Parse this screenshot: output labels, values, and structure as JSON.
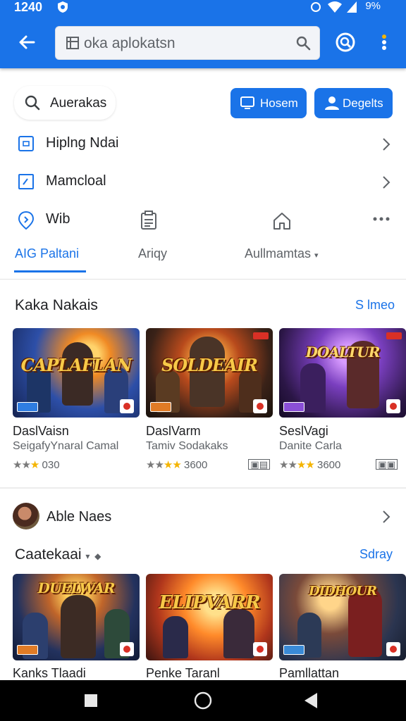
{
  "status": {
    "time": "1240",
    "battery": "9%"
  },
  "search": {
    "value": "oka aplokatsn"
  },
  "quick": {
    "search_label": "Auerakas",
    "button_a": "Hosem",
    "button_b": "Degelts"
  },
  "menu": [
    {
      "label": "Hiplng Ndai"
    },
    {
      "label": "Mamcloal"
    },
    {
      "label": "Wib"
    }
  ],
  "tabs": [
    "AIG Paltani",
    "Ariqy",
    "Aullmamtas"
  ],
  "section1": {
    "title": "Kaka Nakais",
    "link": "S lmeo",
    "cards": [
      {
        "name": "DaslVaisn",
        "sub": "SeigafyYnaral Camal",
        "rating": "030",
        "art": "CAPLAFLAN"
      },
      {
        "name": "DaslVarm",
        "sub": "Tamiv Sodakaks",
        "rating": "3600",
        "art": "SOLDEAIR"
      },
      {
        "name": "SeslVagi",
        "sub": "Danite Carla",
        "rating": "3600",
        "art": "DOALTUR"
      }
    ]
  },
  "section2": {
    "title": "Able Naes",
    "subtitle": "Caatekaai",
    "link": "Sdray",
    "cards": [
      {
        "name": "Kanks Tlaadi",
        "art": "DUELWAR"
      },
      {
        "name": "Penke Taranl",
        "art": "ELIPVARR"
      },
      {
        "name": "Pamllattan",
        "art": "DIDHOUR"
      }
    ]
  },
  "colors": {
    "primary": "#1a73e8",
    "star": "#f4b400"
  }
}
